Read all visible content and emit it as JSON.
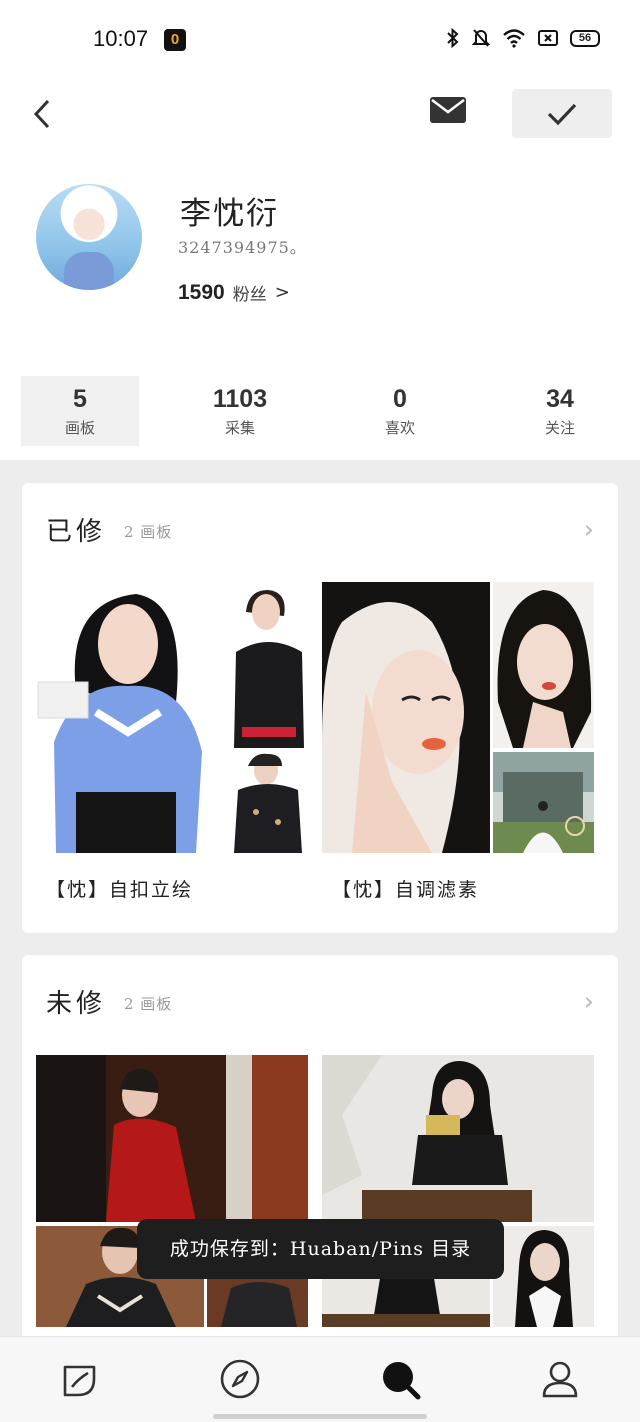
{
  "status_bar": {
    "time": "10:07",
    "app_badge": "0",
    "battery": "56"
  },
  "profile": {
    "name": "李忱衍",
    "id": "3247394975。",
    "followers_count": "1590",
    "followers_label": "粉丝",
    "followers_arrow": ">"
  },
  "stats": [
    {
      "num": "5",
      "label": "画板"
    },
    {
      "num": "1103",
      "label": "采集"
    },
    {
      "num": "0",
      "label": "喜欢"
    },
    {
      "num": "34",
      "label": "关注"
    }
  ],
  "sections": [
    {
      "title": "已修",
      "subtitle": "2 画板",
      "boards": [
        {
          "caption": "【忱】自扣立绘"
        },
        {
          "caption": "【忱】自调滤素"
        }
      ]
    },
    {
      "title": "未修",
      "subtitle": "2 画板"
    }
  ],
  "toast": "成功保存到：Huaban/Pins 目录",
  "colors": {
    "background": "#ededed",
    "card": "#ffffff",
    "toast": "#1e1e1e",
    "accent": "#333333"
  }
}
